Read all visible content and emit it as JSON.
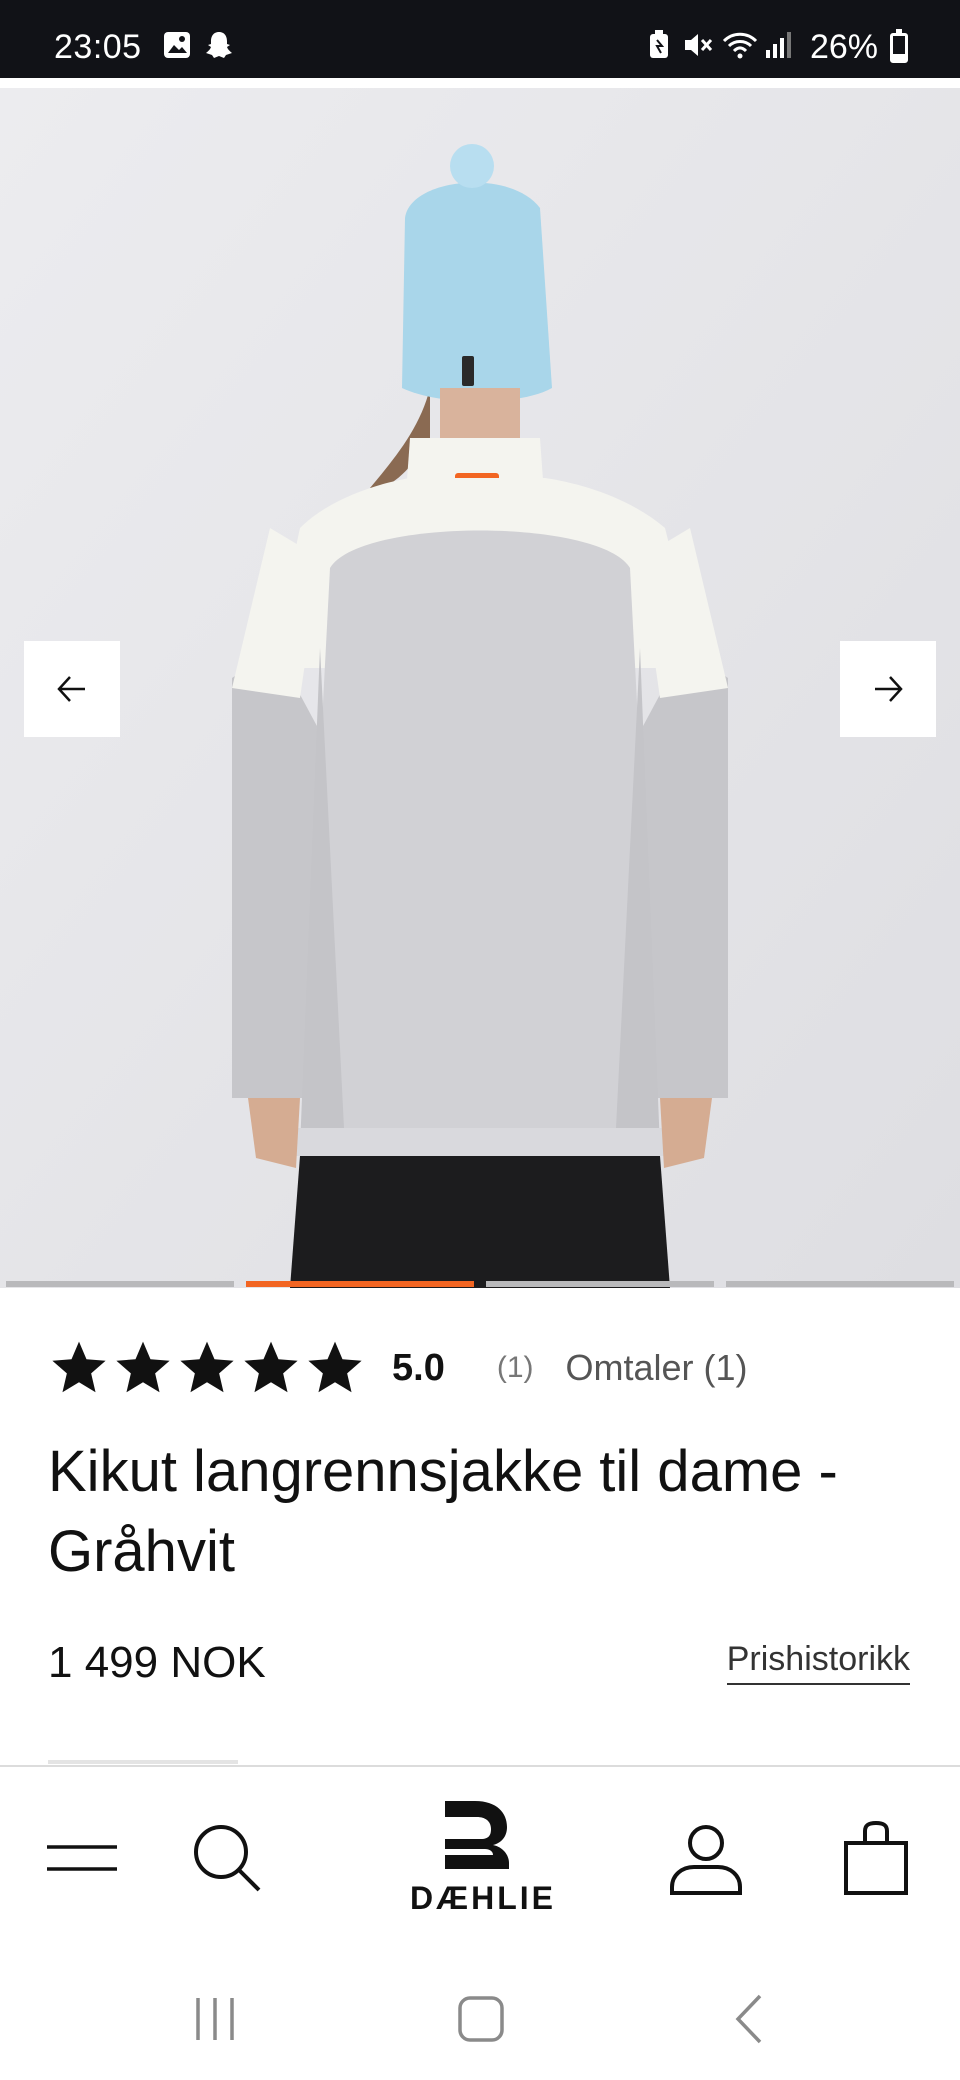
{
  "status_bar": {
    "time": "23:05",
    "battery": "26%",
    "icons": [
      "gallery-icon",
      "snapchat-icon",
      "battery-saver-icon",
      "mute-icon",
      "wifi-icon",
      "signal-icon",
      "battery-icon"
    ]
  },
  "carousel": {
    "prev_icon": "arrow-left-icon",
    "next_icon": "arrow-right-icon",
    "slide_count": 4,
    "active_index": 1,
    "accent_color": "#f26522"
  },
  "product": {
    "rating_value": "5.0",
    "rating_stars": 5,
    "rating_count": "(1)",
    "reviews_label": "Omtaler (1)",
    "title": "Kikut langrennsjakke til dame - Gråhvit",
    "price": "1 499 NOK",
    "price_history_label": "Prishistorikk"
  },
  "bottom_nav": {
    "items": [
      "menu-icon",
      "search-icon",
      "logo",
      "account-icon",
      "cart-icon"
    ],
    "logo_text": "DÆHLIE"
  },
  "system_nav": {
    "items": [
      "recent-apps-icon",
      "home-icon",
      "back-icon"
    ]
  }
}
